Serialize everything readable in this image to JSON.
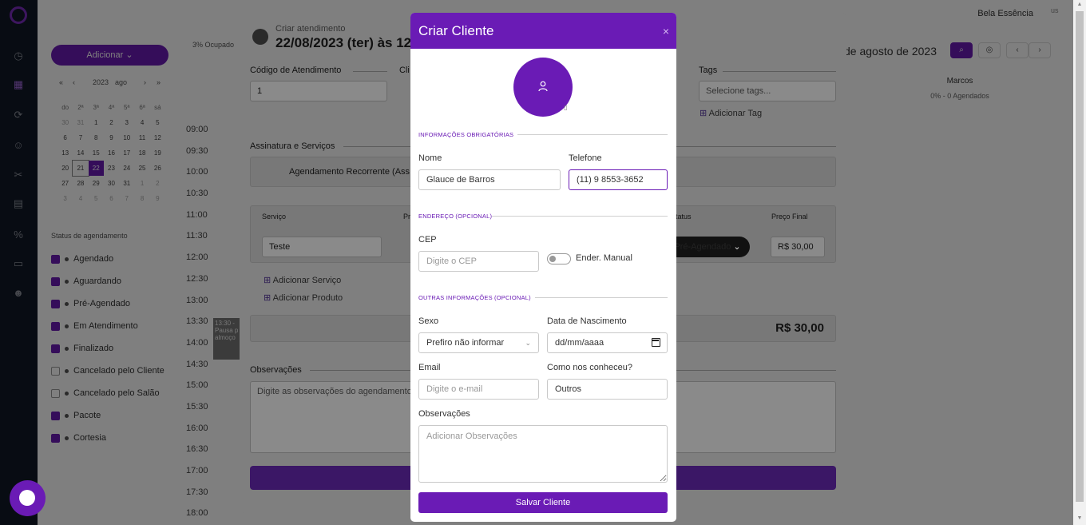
{
  "app": {
    "brand_name": "Bela Essência",
    "avatar_alt": "us"
  },
  "left_panel": {
    "add_button": "Adicionar",
    "mini_calendar": {
      "year": "2023",
      "month": "ago",
      "weekdays": [
        "do",
        "2ª",
        "3ª",
        "4ª",
        "5ª",
        "6ª",
        "sá"
      ],
      "weeks": [
        [
          "30",
          "31",
          "1",
          "2",
          "3",
          "4",
          "5"
        ],
        [
          "6",
          "7",
          "8",
          "9",
          "10",
          "11",
          "12"
        ],
        [
          "13",
          "14",
          "15",
          "16",
          "17",
          "18",
          "19"
        ],
        [
          "20",
          "21",
          "22",
          "23",
          "24",
          "25",
          "26"
        ],
        [
          "27",
          "28",
          "29",
          "30",
          "31",
          "1",
          "2"
        ],
        [
          "3",
          "4",
          "5",
          "6",
          "7",
          "8",
          "9"
        ]
      ],
      "today": "21",
      "selected": "22"
    },
    "status_title": "Status de agendamento",
    "statuses": [
      {
        "label": "Agendado",
        "checked": true
      },
      {
        "label": "Aguardando",
        "checked": true
      },
      {
        "label": "Pré-Agendado",
        "checked": true
      },
      {
        "label": "Em Atendimento",
        "checked": true
      },
      {
        "label": "Finalizado",
        "checked": true
      },
      {
        "label": "Cancelado pelo Cliente",
        "checked": false
      },
      {
        "label": "Cancelado pelo Salão",
        "checked": false
      },
      {
        "label": "Pacote",
        "checked": true
      },
      {
        "label": "Cortesia",
        "checked": true
      }
    ]
  },
  "calendar": {
    "occupancy": "3% Ocupado",
    "date_heading": "de agosto de 2023",
    "times": [
      "09:00",
      "09:30",
      "10:00",
      "10:30",
      "11:00",
      "11:30",
      "12:00",
      "12:30",
      "13:00",
      "13:30",
      "14:00",
      "14:30",
      "15:00",
      "15:30",
      "16:00",
      "16:30",
      "17:00",
      "17:30",
      "18:00"
    ],
    "professional": {
      "name": "Marcos",
      "summary": "0% - 0 Agendados"
    },
    "event_text": "13:30 - Pausa p almoço"
  },
  "background_modal": {
    "subtitle": "Criar atendimento",
    "title": "22/08/2023 (ter) às 12",
    "codigo_label": "Código de Atendimento",
    "codigo_value": "1",
    "cliente_label_partial": "Cli",
    "tags_label": "Tags",
    "tags_placeholder": "Selecione tags...",
    "add_tag": "Adicionar Tag",
    "assinatura_label": "Assinatura e Serviços",
    "recorrente_label": "Agendamento Recorrente (Ass",
    "col_servico": "Serviço",
    "col_partial": "Pr",
    "col_status": "Status",
    "col_preco": "Preço Final",
    "servico_value": "Teste",
    "status_value": "Pré-Agendado",
    "preco_value": "R$ 30,00",
    "add_servico": "Adicionar Serviço",
    "add_produto": "Adicionar Produto",
    "total": "R$ 30,00",
    "obs_label": "Observações",
    "obs_placeholder": "Digite as observações do agendamento"
  },
  "modal": {
    "title": "Criar Cliente",
    "close": "×",
    "section_required": "INFORMAÇÕES OBRIGATÓRIAS",
    "nome_label": "Nome",
    "nome_value": "Glauce de Barros",
    "telefone_label": "Telefone",
    "telefone_value": "(11) 9 8553-3652",
    "section_address": "ENDEREÇO (OPCIONAL)",
    "cep_label": "CEP",
    "cep_placeholder": "Digite o CEP",
    "manual_label": "Ender. Manual",
    "section_other": "OUTRAS INFORMAÇÕES (OPCIONAL)",
    "sexo_label": "Sexo",
    "sexo_value": "Prefiro não informar",
    "nascimento_label": "Data de Nascimento",
    "nascimento_placeholder": "dd/mm/aaaa",
    "email_label": "Email",
    "email_placeholder": "Digite o e-mail",
    "conheceu_label": "Como nos conheceu?",
    "conheceu_value": "Outros",
    "obs_label": "Observações",
    "obs_placeholder": "Adicionar Observações",
    "save_button": "Salvar Cliente"
  }
}
